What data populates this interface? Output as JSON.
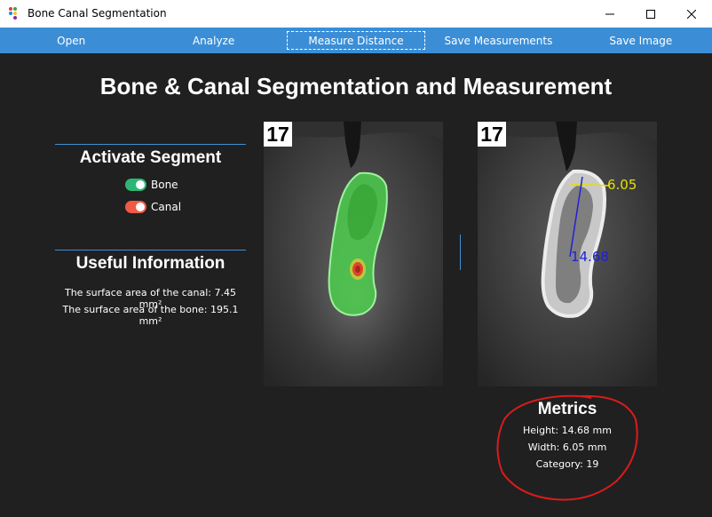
{
  "window": {
    "title": "Bone Canal Segmentation",
    "minimize_glyph": "—",
    "maximize_glyph": "☐",
    "close_glyph": "✕"
  },
  "toolbar": {
    "items": [
      {
        "label": "Open"
      },
      {
        "label": "Analyze"
      },
      {
        "label": "Measure Distance"
      },
      {
        "label": "Save Measurements"
      },
      {
        "label": "Save Image"
      }
    ]
  },
  "main": {
    "title": "Bone & Canal Segmentation and Measurement"
  },
  "segments": {
    "heading": "Activate Segment",
    "items": [
      {
        "label": "Bone",
        "color": "#2bb673",
        "enabled": true
      },
      {
        "label": "Canal",
        "color": "#f05a45",
        "enabled": true
      }
    ]
  },
  "info": {
    "heading": "Useful Information",
    "canal_area": "The surface area of the canal: 7.45 mm²",
    "bone_area": "The surface area of the bone: 195.1 mm²"
  },
  "images": {
    "left_label": "17",
    "right_label": "17",
    "width_measure": "6.05",
    "height_measure": "14.68",
    "width_color": "#e6e000",
    "height_color": "#2020d8",
    "bone_overlay_color": "#4cd44c",
    "canal_overlay_color": "#e0452c"
  },
  "metrics": {
    "title": "Metrics",
    "height": "Height: 14.68 mm",
    "width": "Width: 6.05 mm",
    "category": "Category: 19",
    "annotation_color": "#d81c1c"
  }
}
